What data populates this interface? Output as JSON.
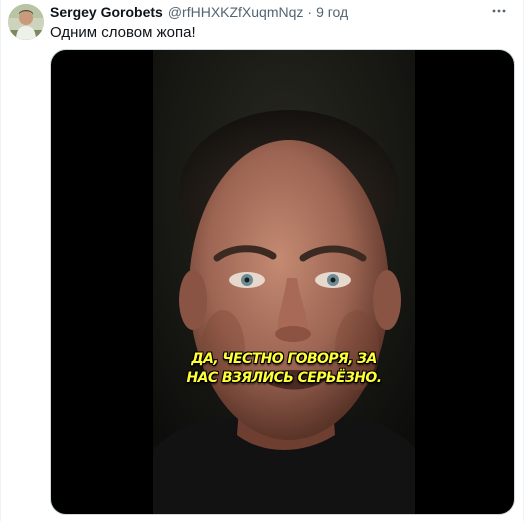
{
  "tweet": {
    "author_name": "Sergey Gorobets",
    "author_handle": "@rfHHXKZfXuqmNqz",
    "separator": "·",
    "timestamp": "9 год",
    "text": "Одним словом жопа!",
    "more_icon": "more-dots-icon"
  },
  "media": {
    "type": "video",
    "subtitle_lines": [
      "ДА, ЧЕСТНО ГОВОРЯ, ЗА",
      "НАС ВЗЯЛИСЬ СЕРЬЁЗНО."
    ],
    "subtitle_color": "#ffff3a"
  },
  "colors": {
    "text_primary": "#0f1419",
    "text_secondary": "#536471",
    "border": "#cfd9de"
  }
}
